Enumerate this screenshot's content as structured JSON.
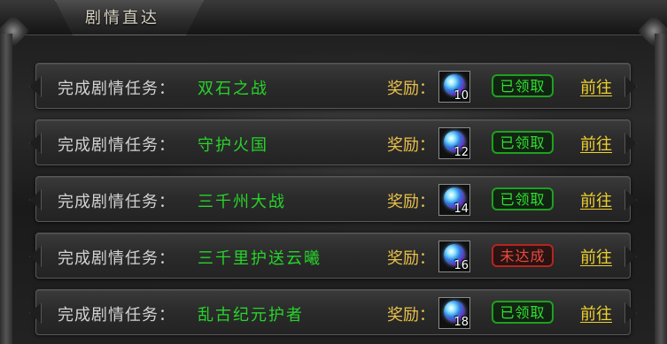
{
  "panel": {
    "title": "剧情直达"
  },
  "quests": [
    {
      "prefix": "完成剧情任务：",
      "name": "双石之战",
      "reward_label": "奖励：",
      "reward_icon": "crystal-orb-icon",
      "reward_count": "10",
      "status": "已领取",
      "status_type": "claimed",
      "goto": "前往"
    },
    {
      "prefix": "完成剧情任务：",
      "name": "守护火国",
      "reward_label": "奖励：",
      "reward_icon": "crystal-orb-icon",
      "reward_count": "12",
      "status": "已领取",
      "status_type": "claimed",
      "goto": "前往"
    },
    {
      "prefix": "完成剧情任务：",
      "name": "三千州大战",
      "reward_label": "奖励：",
      "reward_icon": "crystal-orb-icon",
      "reward_count": "14",
      "status": "已领取",
      "status_type": "claimed",
      "goto": "前往"
    },
    {
      "prefix": "完成剧情任务：",
      "name": "三千里护送云曦",
      "reward_label": "奖励：",
      "reward_icon": "crystal-orb-icon",
      "reward_count": "16",
      "status": "未达成",
      "status_type": "unmet",
      "goto": "前往"
    },
    {
      "prefix": "完成剧情任务：",
      "name": "乱古纪元护者",
      "reward_label": "奖励：",
      "reward_icon": "crystal-orb-icon",
      "reward_count": "18",
      "status": "已领取",
      "status_type": "claimed",
      "goto": "前往"
    }
  ],
  "colors": {
    "quest_name": "#27d42a",
    "reward_label": "#e8c04a",
    "claimed": "#2fe02f",
    "unmet": "#e84b3c",
    "goto": "#f0d12e"
  }
}
